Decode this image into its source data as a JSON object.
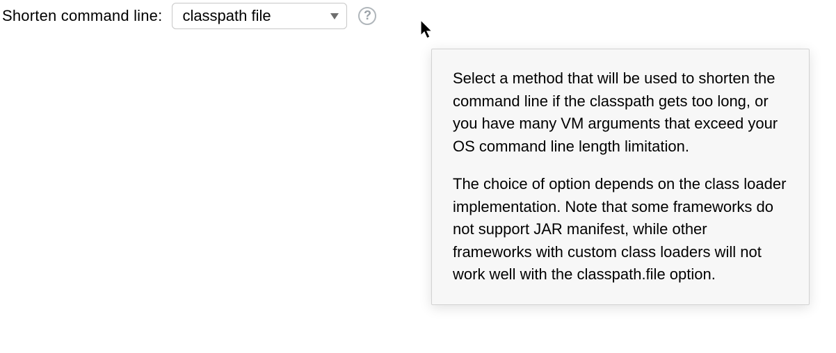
{
  "field": {
    "label": "Shorten command line:",
    "selected": "classpath file"
  },
  "tooltip": {
    "p1": "Select a method that will be used to shorten the command line if the classpath gets too long, or you have many VM arguments that exceed your OS command line length limitation.",
    "p2": "The choice of option depends on the class loader implementation. Note that some frameworks do not support JAR manifest, while other frameworks with custom class loaders will not work well with the classpath.file option."
  }
}
